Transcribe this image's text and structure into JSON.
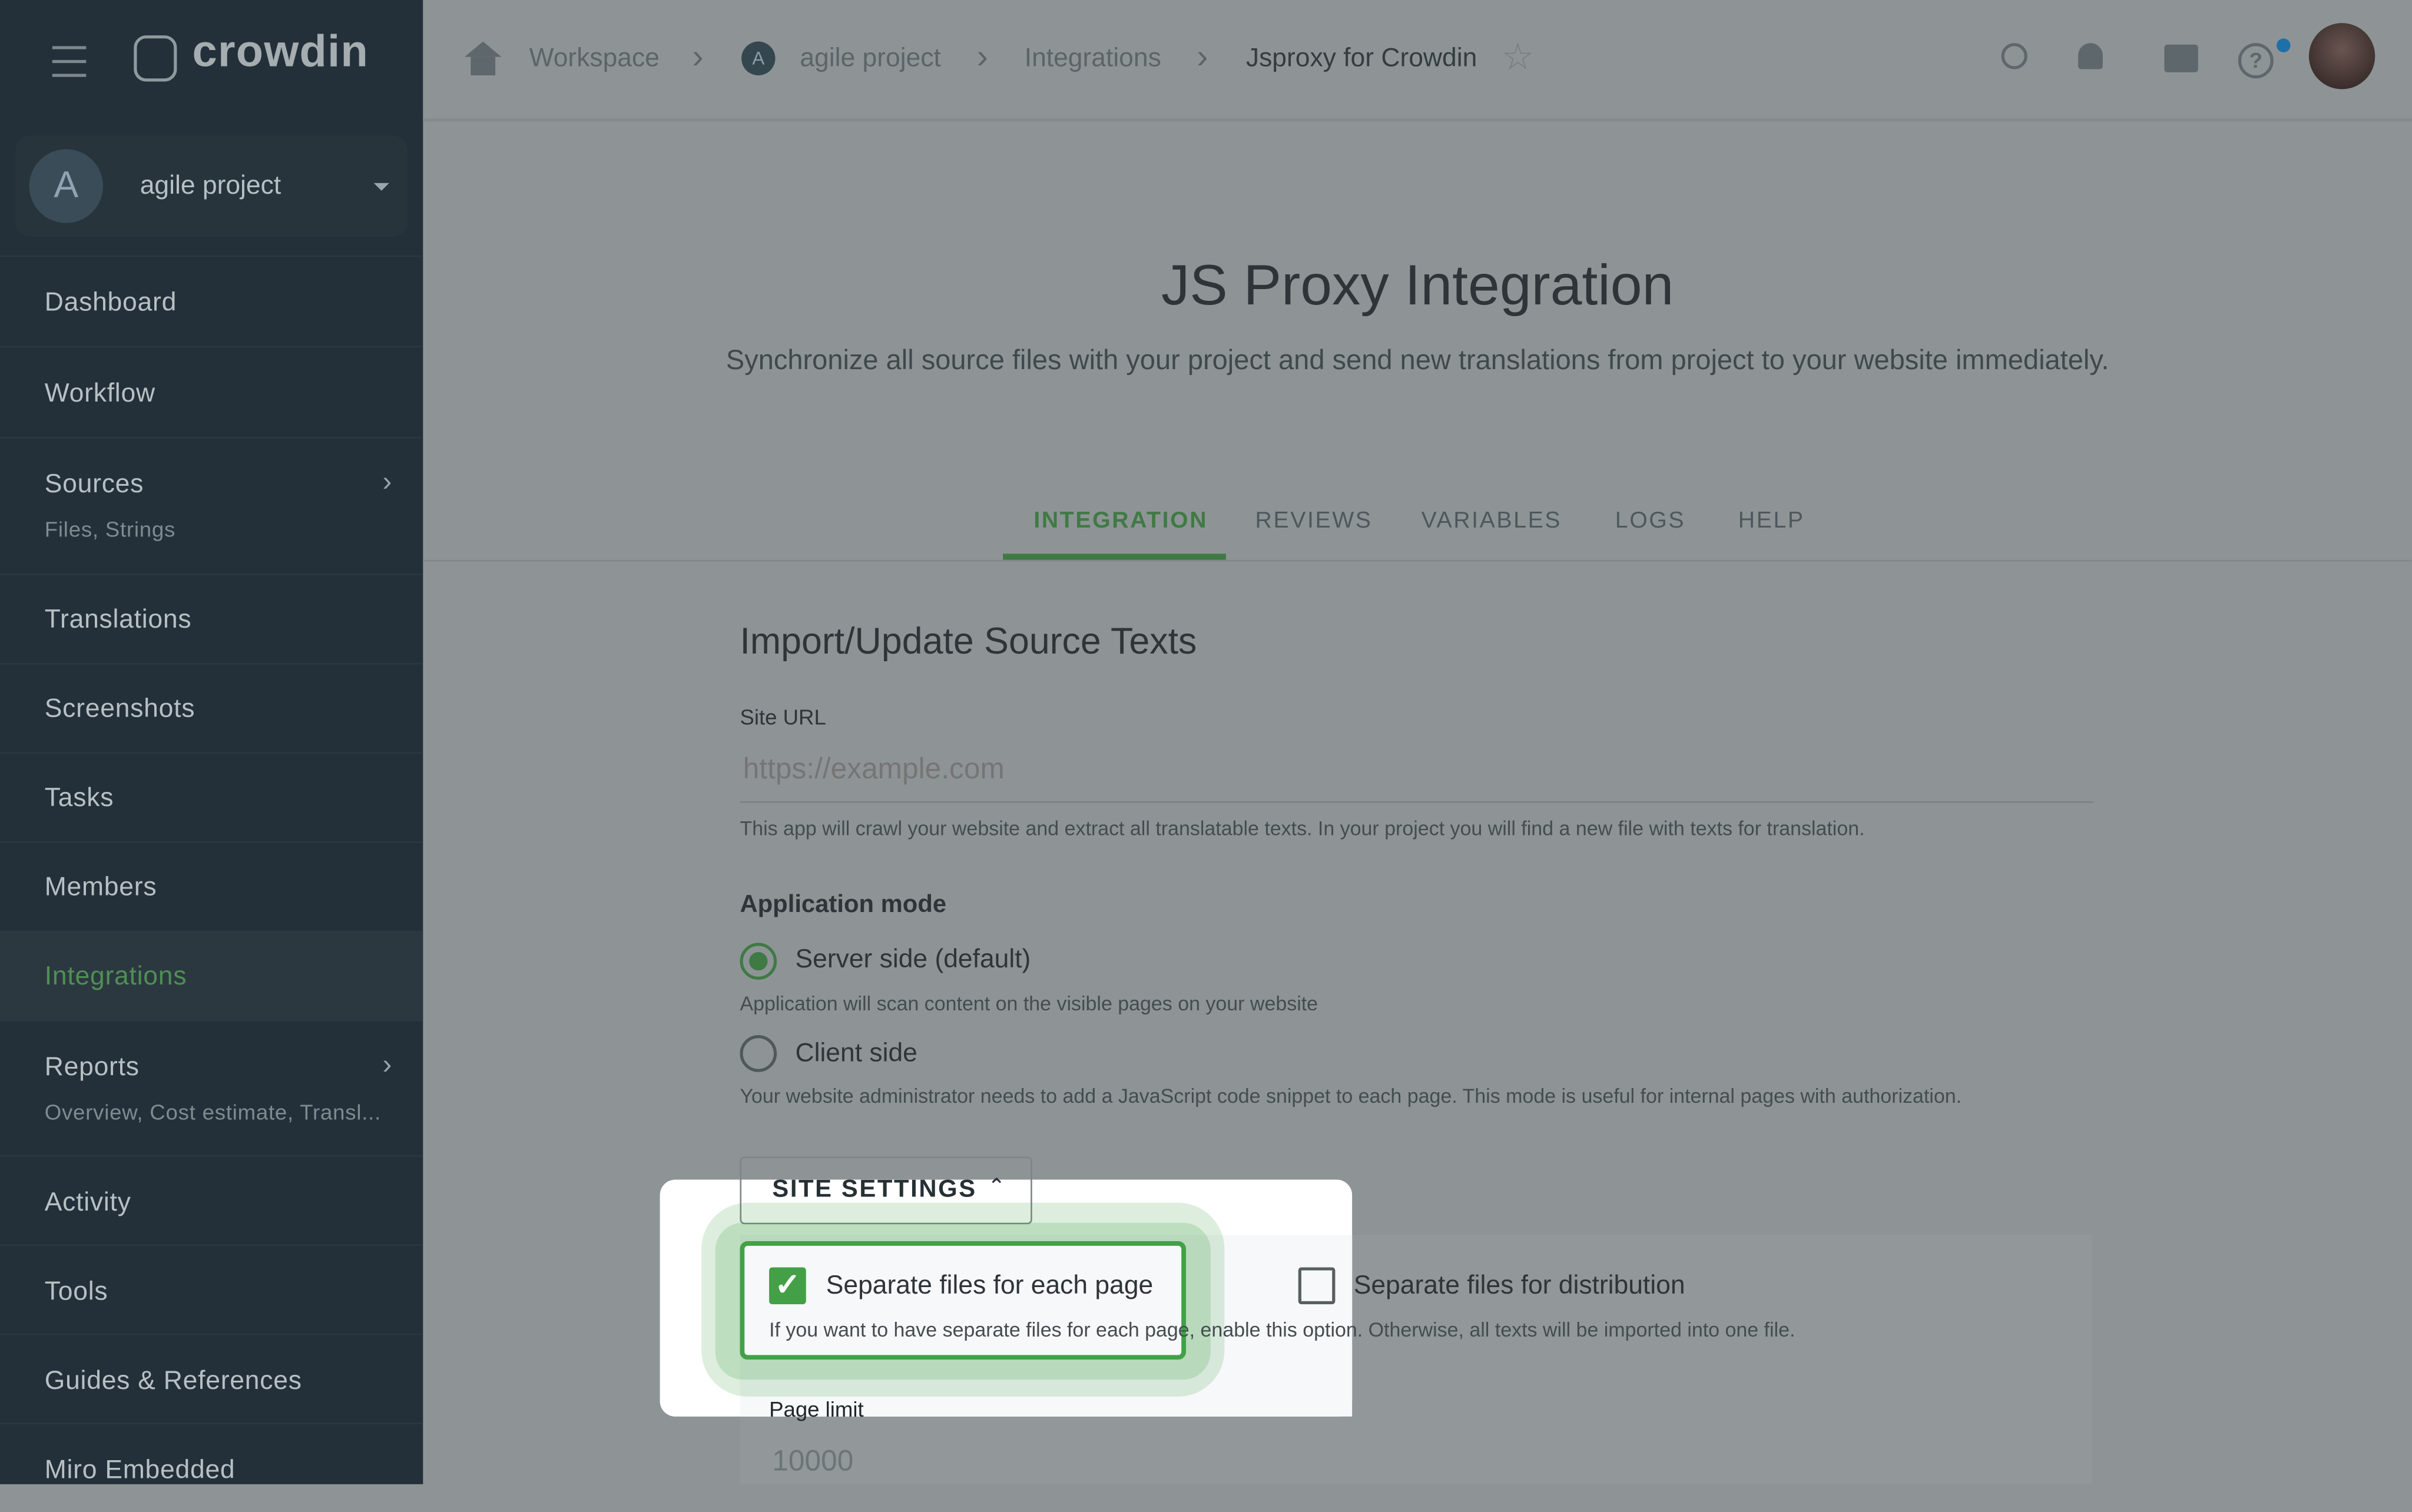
{
  "app": {
    "logo": "crowdin",
    "menu_icon": "hamburger-icon"
  },
  "project_selector": {
    "avatar": "A",
    "name": "agile project"
  },
  "sidebar": {
    "items": [
      {
        "label": "Dashboard"
      },
      {
        "label": "Workflow"
      },
      {
        "label": "Sources",
        "sub": "Files, Strings"
      },
      {
        "label": "Translations"
      },
      {
        "label": "Screenshots"
      },
      {
        "label": "Tasks"
      },
      {
        "label": "Members"
      },
      {
        "label": "Integrations",
        "active": true
      },
      {
        "label": "Reports",
        "sub": "Overview, Cost estimate, Transl..."
      },
      {
        "label": "Activity"
      },
      {
        "label": "Tools"
      },
      {
        "label": "Guides & References"
      },
      {
        "label": "Miro Embedded"
      }
    ]
  },
  "breadcrumb": {
    "workspace": "Workspace",
    "project_avatar": "A",
    "project": "agile project",
    "integrations": "Integrations",
    "current": "Jsproxy for Crowdin"
  },
  "header_icons": [
    "search-icon",
    "bell-icon",
    "chat-icon",
    "help-icon",
    "avatar"
  ],
  "page": {
    "title": "JS Proxy Integration",
    "subtitle": "Synchronize all source files with your project and send new translations from project to your website immediately."
  },
  "tabs": [
    {
      "label": "INTEGRATION",
      "active": true
    },
    {
      "label": "REVIEWS"
    },
    {
      "label": "VARIABLES"
    },
    {
      "label": "LOGS"
    },
    {
      "label": "HELP"
    }
  ],
  "form": {
    "section_title": "Import/Update Source Texts",
    "site_url_label": "Site URL",
    "site_url_placeholder": "https://example.com",
    "site_url_help": "This app will crawl your website and extract all translatable texts. In your project you will find a new file with texts for translation.",
    "mode_label": "Application mode",
    "mode_server": "Server side (default)",
    "mode_server_help": "Application will scan content on the visible pages on your website",
    "mode_client": "Client side",
    "mode_client_help": "Your website administrator needs to add a JavaScript code snippet to each page. This mode is useful for internal pages with authorization.",
    "selected_mode": "Server side (default)",
    "site_settings_button": "SITE SETTINGS",
    "separate_pages": "Separate files for each page",
    "separate_pages_checked": true,
    "separate_pages_help": "If you want to have separate files for each page, enable this option. Otherwise, all texts will be imported into one file.",
    "separate_distribution": "Separate files for distribution",
    "separate_distribution_checked": false,
    "page_limit_label": "Page limit",
    "page_limit_value": "10000"
  },
  "colors": {
    "accent": "#43a047",
    "sidebar": "#243039"
  }
}
